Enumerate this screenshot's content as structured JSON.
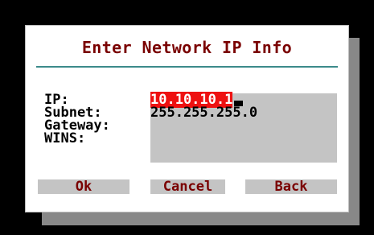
{
  "dialog": {
    "title": "Enter Network IP Info",
    "fields": [
      {
        "label": "IP:",
        "value": "10.10.10.1",
        "selected": true
      },
      {
        "label": "Subnet:",
        "value": "255.255.255.0"
      },
      {
        "label": "Gateway:",
        "value": ""
      },
      {
        "label": "WINS:",
        "value": ""
      }
    ],
    "buttons": {
      "ok": "Ok",
      "cancel": "Cancel",
      "back": "Back"
    }
  },
  "colors": {
    "screen_background": "#000000",
    "dialog_background": "#ffffff",
    "shadow": "#888888",
    "title_text": "#7a0000",
    "divider": "#3c8b8b",
    "field_background": "#c4c4c4",
    "selection_background": "#ee1111",
    "button_background": "#c4c4c4",
    "button_text": "#7a0000"
  }
}
